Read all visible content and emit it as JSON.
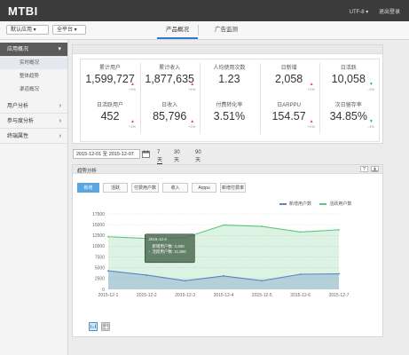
{
  "header": {
    "logo": "MTBI",
    "right_items": [
      "UTF-8 ▾",
      "退出登录"
    ]
  },
  "subbar": {
    "selects": [
      "默认应用 ▾",
      "全平台 ▾"
    ],
    "tabs": [
      {
        "label": "产品概况",
        "active": true
      },
      {
        "label": "广告监测",
        "active": false
      }
    ]
  },
  "sidebar": {
    "items": [
      {
        "label": "应用概况",
        "active": true,
        "chevron": "▾"
      },
      {
        "label": "用户分析",
        "active": false,
        "chevron": "›"
      },
      {
        "label": "参与度分析",
        "active": false,
        "chevron": "›"
      },
      {
        "label": "终端属性",
        "active": false,
        "chevron": "›"
      }
    ],
    "subitems": [
      {
        "label": "实时概况",
        "active": true
      },
      {
        "label": "整体趋势",
        "active": false
      },
      {
        "label": "渠道概况",
        "active": false
      }
    ]
  },
  "kpis": [
    {
      "top_label": "累计用户",
      "top_value": "1,599,727",
      "top_change": "+1%",
      "top_dir": "up",
      "bottom_label": "日活跃用户",
      "bottom_value": "452",
      "bottom_change": "+1%",
      "bottom_dir": "up"
    },
    {
      "top_label": "累计收入",
      "top_value": "1,877,635",
      "top_change": "+1%",
      "top_dir": "up",
      "bottom_label": "日收入",
      "bottom_value": "85,796",
      "bottom_change": "+1%",
      "bottom_dir": "up"
    },
    {
      "top_label": "人均使用次数",
      "top_value": "1.23",
      "top_change": "",
      "top_dir": "",
      "bottom_label": "付费转化率",
      "bottom_value": "3.51%",
      "bottom_change": "",
      "bottom_dir": ""
    },
    {
      "top_label": "日新增",
      "top_value": "2,058",
      "top_change": "+1%",
      "top_dir": "up",
      "bottom_label": "日ARPPU",
      "bottom_value": "154.57",
      "bottom_change": "+1%",
      "bottom_dir": "up"
    },
    {
      "top_label": "日活跃",
      "top_value": "10,058",
      "top_change": "-1%",
      "top_dir": "down",
      "bottom_label": "次日留存率",
      "bottom_value": "34.85%",
      "bottom_change": "-1%",
      "bottom_dir": "down"
    }
  ],
  "daterange": {
    "value": "2015-12-01 至 2015-12-07",
    "quick": [
      {
        "label": "7天",
        "active": true
      },
      {
        "label": "30天",
        "active": false
      },
      {
        "label": "90天",
        "active": false
      }
    ]
  },
  "chart_panel": {
    "title": "趋势分析",
    "help_icon": "?",
    "tabs": [
      {
        "label": "新增",
        "active": true
      },
      {
        "label": "活跃",
        "active": false
      },
      {
        "label": "付费用户数",
        "active": false
      },
      {
        "label": "收入",
        "active": false
      },
      {
        "label": "Arppu",
        "active": false
      },
      {
        "label": "新增付费率",
        "active": false
      }
    ]
  },
  "chart_data": {
    "type": "area",
    "categories": [
      "2015-12-1",
      "2015-12-2",
      "2015-12-3",
      "2015-12-4",
      "2015-12-5",
      "2015-12-6",
      "2015-12-7"
    ],
    "series": [
      {
        "name": "新增用户数",
        "color": "#5b84c4",
        "values": [
          4300,
          3300,
          2000,
          3100,
          2000,
          3500,
          3600
        ]
      },
      {
        "name": "活跃用户数",
        "color": "#5fc77f",
        "values": [
          12200,
          11800,
          12000,
          14900,
          14600,
          13300,
          13800
        ]
      }
    ],
    "yticks": [
      "0",
      "2500",
      "5000",
      "7500",
      "10000",
      "12500",
      "15000",
      "17500"
    ],
    "ylim": [
      0,
      17500
    ],
    "tooltip": {
      "title": "2015-12-2",
      "rows": [
        "新增用户数: 3,300",
        "活跃用户数: 11,800"
      ]
    }
  }
}
